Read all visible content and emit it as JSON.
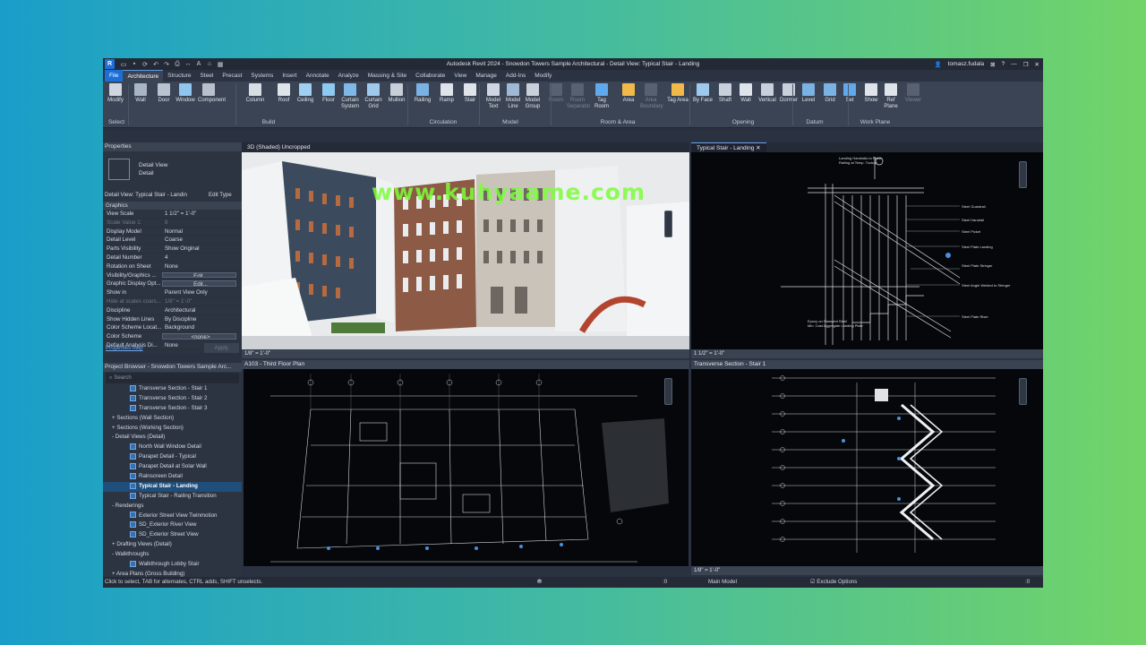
{
  "app": {
    "logo": "R",
    "title": "Autodesk Revit 2024 - Snowdon Towers Sample Architectural - Detail View: Typical Stair - Landing"
  },
  "user": {
    "name": "tomasz.fudala"
  },
  "ribbon_tabs": [
    "File",
    "Architecture",
    "Structure",
    "Steel",
    "Precast",
    "Systems",
    "Insert",
    "Annotate",
    "Analyze",
    "Massing & Site",
    "Collaborate",
    "View",
    "Manage",
    "Add-Ins",
    "Modify"
  ],
  "tools": [
    {
      "label": "Modify",
      "color": "#cfd6e2"
    },
    {
      "label": "Wall",
      "color": "#a9b4c4"
    },
    {
      "label": "Door",
      "color": "#b9c2cf"
    },
    {
      "label": "Window",
      "color": "#8fc5ef"
    },
    {
      "label": "Component",
      "color": "#b8c0cc"
    },
    {
      "label": "Column",
      "color": "#d9dde4"
    },
    {
      "label": "Roof",
      "color": "#dfe3ea"
    },
    {
      "label": "Ceiling",
      "color": "#9fd0f2"
    },
    {
      "label": "Floor",
      "color": "#8ec9f0"
    },
    {
      "label": "Curtain System",
      "color": "#7fb8e6"
    },
    {
      "label": "Curtain Grid",
      "color": "#9fc9ec"
    },
    {
      "label": "Mullion",
      "color": "#c8ced8"
    },
    {
      "label": "Railing",
      "color": "#7ab2e4"
    },
    {
      "label": "Ramp",
      "color": "#dfe3ea"
    },
    {
      "label": "Stair",
      "color": "#dfe3ea"
    },
    {
      "label": "Model Text",
      "color": "#cfd6e2"
    },
    {
      "label": "Model Line",
      "color": "#9fb8d6"
    },
    {
      "label": "Model Group",
      "color": "#c8d0dc"
    },
    {
      "label": "Room",
      "color": "#8f98a6"
    },
    {
      "label": "Room Separator",
      "color": "#8f98a6"
    },
    {
      "label": "Tag Room",
      "color": "#5fa9ec"
    },
    {
      "label": "Area",
      "color": "#f0b94a"
    },
    {
      "label": "Area Boundary",
      "color": "#8f98a6"
    },
    {
      "label": "Tag Area",
      "color": "#f0b94a"
    },
    {
      "label": "By Face",
      "color": "#9fc9ec"
    },
    {
      "label": "Shaft",
      "color": "#c8d0dc"
    },
    {
      "label": "Wall",
      "color": "#dfe3ea"
    },
    {
      "label": "Vertical",
      "color": "#c8d0dc"
    },
    {
      "label": "Dormer",
      "color": "#c8d0dc"
    },
    {
      "label": "Level",
      "color": "#7ab2e4"
    },
    {
      "label": "Grid",
      "color": "#7ab2e4"
    },
    {
      "label": "Set",
      "color": "#5fa9ec"
    },
    {
      "label": "Show",
      "color": "#dfe3ea"
    },
    {
      "label": "Ref Plane",
      "color": "#dfe3ea"
    },
    {
      "label": "Viewer",
      "color": "#8f98a6"
    }
  ],
  "panels": [
    "Select",
    "Build",
    "Circulation",
    "Model",
    "Room & Area",
    "Opening",
    "Datum",
    "Work Plane"
  ],
  "properties": {
    "title": "Properties",
    "type_name": "Detail View",
    "type_sub": "Detail",
    "selector": "Detail View: Typical Stair - Landin",
    "edit_type": "Edit Type",
    "group": "Graphics",
    "rows": [
      {
        "k": "View Scale",
        "v": "1 1/2\" = 1'-0\""
      },
      {
        "k": "Scale Value 1:",
        "v": "8",
        "dim": true
      },
      {
        "k": "Display Model",
        "v": "Normal"
      },
      {
        "k": "Detail Level",
        "v": "Coarse"
      },
      {
        "k": "Parts Visibility",
        "v": "Show Original"
      },
      {
        "k": "Detail Number",
        "v": "4"
      },
      {
        "k": "Rotation on Sheet",
        "v": "None"
      },
      {
        "k": "Visibility/Graphics ...",
        "v": "Edit...",
        "btn": true
      },
      {
        "k": "Graphic Display Opt...",
        "v": "Edit...",
        "btn": true
      },
      {
        "k": "Show in",
        "v": "Parent View Only"
      },
      {
        "k": "Hide at scales coars...",
        "v": "1/8\" = 1'-0\"",
        "dim": true
      },
      {
        "k": "Discipline",
        "v": "Architectural"
      },
      {
        "k": "Show Hidden Lines",
        "v": "By Discipline"
      },
      {
        "k": "Color Scheme Locat...",
        "v": "Background"
      },
      {
        "k": "Color Scheme",
        "v": "<none>",
        "btn": true
      },
      {
        "k": "Default Analysis Di...",
        "v": "None"
      }
    ],
    "help": "Properties help",
    "apply": "Apply"
  },
  "project_browser": {
    "title": "Project Browser - Snowdon Towers Sample Arc...",
    "search": "Search",
    "items": [
      {
        "t": "Transverse Section - Stair 1",
        "lvl": 3
      },
      {
        "t": "Transverse Section - Stair 2",
        "lvl": 3
      },
      {
        "t": "Transverse Section - Stair 3",
        "lvl": 3
      },
      {
        "t": "Sections (Wall Section)",
        "lvl": 1,
        "exp": "+"
      },
      {
        "t": "Sections (Working Section)",
        "lvl": 1,
        "exp": "+"
      },
      {
        "t": "Detail Views (Detail)",
        "lvl": 1,
        "exp": "-"
      },
      {
        "t": "North Wall Window Detail",
        "lvl": 3
      },
      {
        "t": "Parapet Detail - Typical",
        "lvl": 3
      },
      {
        "t": "Parapet Detail at Solar Wall",
        "lvl": 3
      },
      {
        "t": "Rainscreen Detail",
        "lvl": 3
      },
      {
        "t": "Typical Stair - Landing",
        "lvl": 3,
        "sel": true
      },
      {
        "t": "Typical Stair - Railing Transition",
        "lvl": 3
      },
      {
        "t": "Renderings",
        "lvl": 1,
        "exp": "-"
      },
      {
        "t": "Exterior Street View Twinmotion",
        "lvl": 3
      },
      {
        "t": "SD_Exterior River View",
        "lvl": 3
      },
      {
        "t": "SD_Exterior Street View",
        "lvl": 3
      },
      {
        "t": "Drafting Views (Detail)",
        "lvl": 1,
        "exp": "+"
      },
      {
        "t": "Walkthroughs",
        "lvl": 1,
        "exp": "-"
      },
      {
        "t": "Walkthrough Lobby Stair",
        "lvl": 3
      },
      {
        "t": "Area Plans (Gross Building)",
        "lvl": 1,
        "exp": "+"
      }
    ]
  },
  "views": {
    "v3d": {
      "tab": "3D (Shaded) Uncropped",
      "scale": "1/8\" = 1'-0\""
    },
    "detail": {
      "tab": "Typical Stair - Landing",
      "scale": "1 1/2\" = 1'-0\"",
      "notes": [
        "Landing Handrails to Finish",
        "Railing at Temp. Tuckup",
        "Steel Guardrail",
        "Steel Handrail",
        "Steel Picket",
        "Steel Plate Landing",
        "Steel Plate Stringer",
        "Steel Angle Welded to Stringer",
        "Steel Plate Riser",
        "Epoxy on Stamped Steel",
        "Min. Cast Aggregate Landing Plate"
      ]
    },
    "plan": {
      "tab": "A103 - Third Floor Plan"
    },
    "section": {
      "tab": "Transverse Section - Stair 1",
      "scale": "1/8\" = 1'-0\""
    }
  },
  "status": {
    "hint": "Click to select, TAB for alternates, CTRL adds, SHIFT unselects.",
    "coord": ":0",
    "model": "Main Model",
    "exclude": "Exclude Options",
    "filter": ":0"
  },
  "watermark": "www.kuhyaame.com"
}
